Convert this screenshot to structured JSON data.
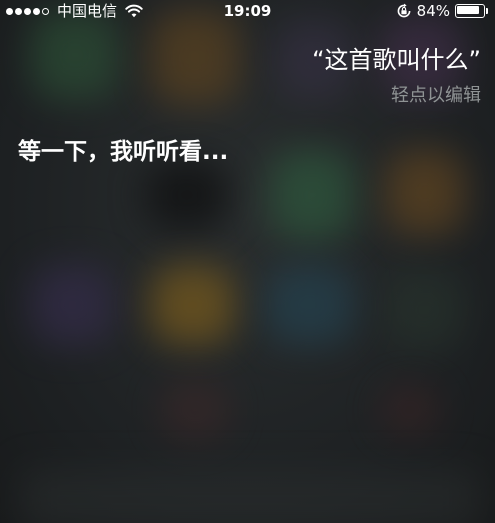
{
  "status_bar": {
    "signal_strength": 4,
    "signal_max": 5,
    "carrier": "中国电信",
    "wifi_icon": "wifi-icon",
    "time": "19:09",
    "rotation_lock_icon": "rotation-lock-icon",
    "battery_percent_label": "84%",
    "battery_level": 0.84,
    "battery_icon": "battery-icon"
  },
  "siri": {
    "user_query": "“这首歌叫什么”",
    "edit_hint": "轻点以编辑",
    "response": "等一下，我听听看..."
  }
}
